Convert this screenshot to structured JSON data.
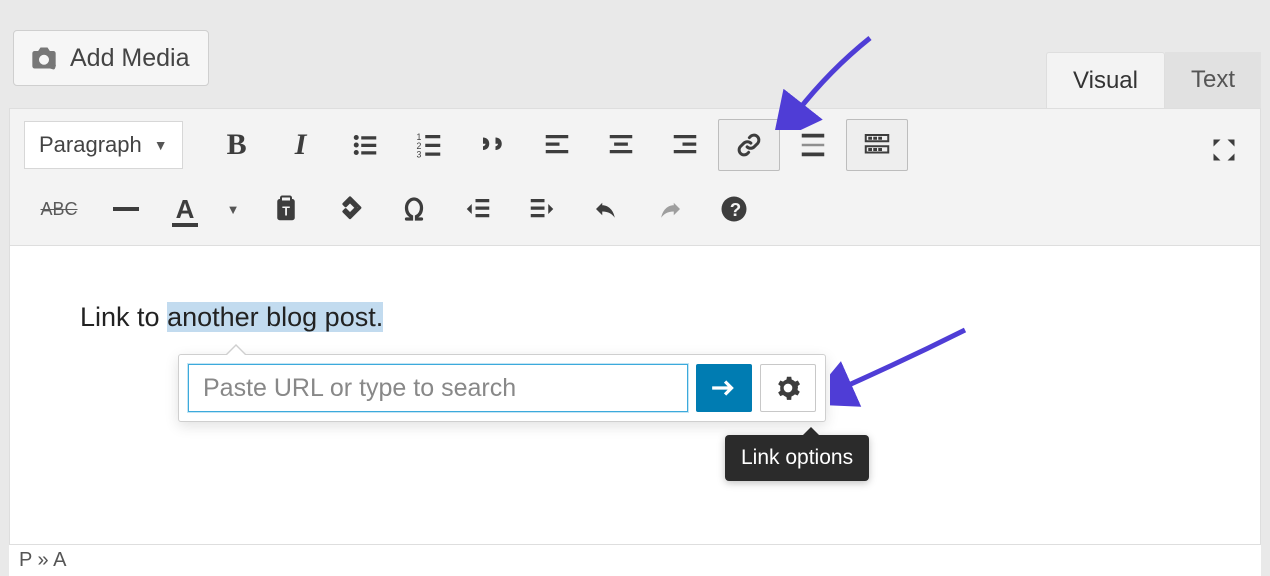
{
  "add_media_label": "Add Media",
  "tabs": {
    "visual": "Visual",
    "text": "Text"
  },
  "format_dropdown": "Paragraph",
  "editor_text": {
    "prefix": "Link to ",
    "selected": "another blog post.",
    "suffix": ""
  },
  "link_popup": {
    "placeholder": "Paste URL or type to search",
    "value": ""
  },
  "tooltip": "Link options",
  "status_path": "P » A",
  "icons": {
    "media": "media-icon",
    "bold": "bold-icon",
    "italic": "italic-icon",
    "ul": "bulleted-list-icon",
    "ol": "numbered-list-icon",
    "quote": "blockquote-icon",
    "alignleft": "align-left-icon",
    "aligncenter": "align-center-icon",
    "alignright": "align-right-icon",
    "link": "link-icon",
    "more": "read-more-icon",
    "toolbar": "toolbar-toggle-icon",
    "fullscreen": "fullscreen-icon",
    "strike": "strikethrough-icon",
    "hr": "horizontal-rule-icon",
    "textcolor": "text-color-icon",
    "paste": "paste-text-icon",
    "clear": "clear-formatting-icon",
    "specialchar": "special-character-icon",
    "outdent": "outdent-icon",
    "indent": "indent-icon",
    "undo": "undo-icon",
    "redo": "redo-icon",
    "help": "help-icon",
    "apply": "apply-icon",
    "gear": "gear-icon"
  }
}
